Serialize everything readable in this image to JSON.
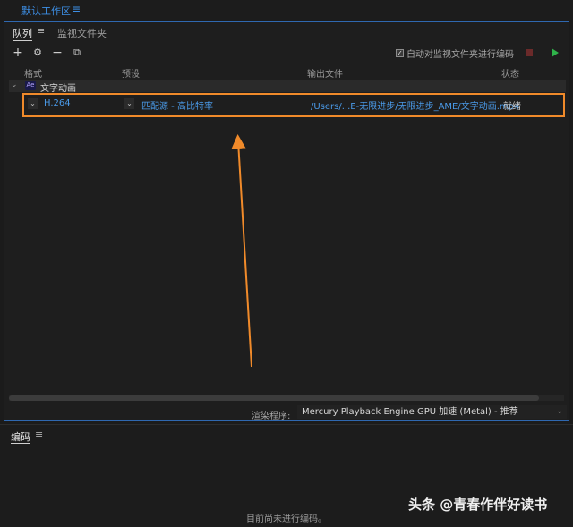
{
  "topbar": {
    "workspace": "默认工作区",
    "menu_glyph": "≡"
  },
  "queue": {
    "tabs": [
      {
        "label": "队列",
        "menu_glyph": "≡"
      },
      {
        "label": "监视文件夹"
      }
    ],
    "toolbar": {
      "add": "+",
      "settings": "⚙",
      "remove": "−",
      "duplicate": "⧉"
    },
    "auto_watch": {
      "checked": true,
      "label": "自动对监视文件夹进行编码"
    },
    "columns": {
      "format": "格式",
      "preset": "预设",
      "output": "输出文件",
      "status": "状态"
    },
    "group": {
      "badge": "Ae",
      "name": "文字动画"
    },
    "item": {
      "format": "H.264",
      "preset": "匹配源 - 高比特率",
      "output": "/Users/...E-无限进步/无限进步_AME/文字动画.mp4",
      "status": "就绪"
    },
    "renderer": {
      "label": "渲染程序:",
      "value": "Mercury Playback Engine GPU 加速 (Metal) - 推荐"
    }
  },
  "encode": {
    "title": "编码",
    "menu_glyph": "≡",
    "empty_message": "目前尚未进行编码。"
  },
  "watermark": "头条 @青春作伴好读书",
  "colors": {
    "accent": "#3d8fe6",
    "highlight": "#f08a2a",
    "play": "#2fb34a",
    "stop": "#6b2a2a"
  }
}
